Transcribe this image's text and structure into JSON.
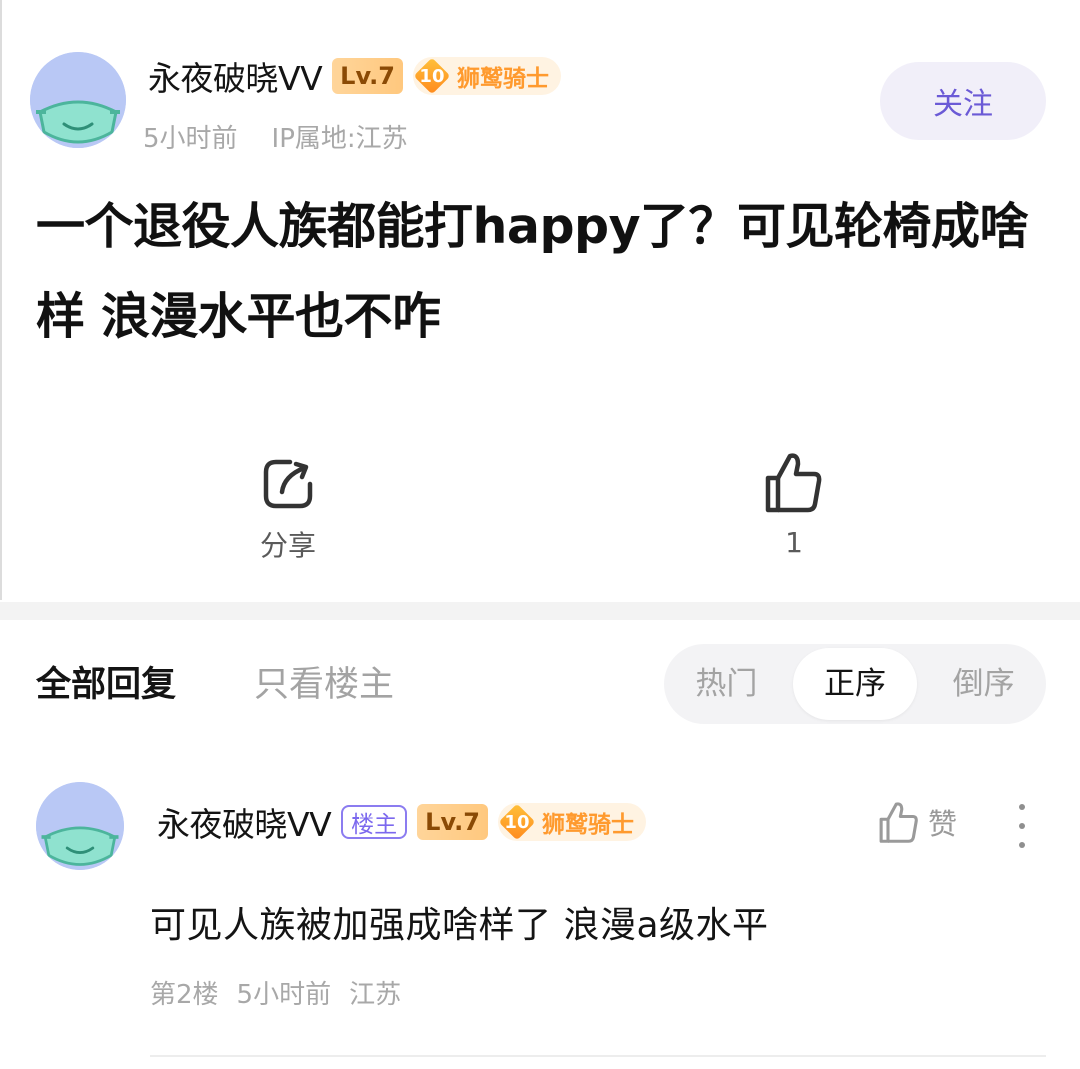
{
  "post": {
    "author": "永夜破晓VV",
    "level": "Lv.7",
    "title_badge_num": "10",
    "title_badge": "狮鹫骑士",
    "time": "5小时前",
    "ip": "IP属地:江苏",
    "follow_label": "关注",
    "title": "一个退役人族都能打happy了？可见轮椅成啥样 浪漫水平也不咋",
    "share_label": "分享",
    "like_count": "1"
  },
  "replies_header": {
    "all_label": "全部回复",
    "owner_only_label": "只看楼主",
    "sort_options": [
      "热门",
      "正序",
      "倒序"
    ],
    "active_sort": "正序"
  },
  "reply": {
    "author": "永夜破晓VV",
    "owner_badge": "楼主",
    "level": "Lv.7",
    "title_badge_num": "10",
    "title_badge": "狮鹫骑士",
    "like_label": "赞",
    "content": "可见人族被加强成啥样了 浪漫a级水平",
    "floor": "第2楼",
    "time": "5小时前",
    "location": "江苏"
  },
  "icons": {
    "avatar": "masked-face-avatar",
    "share": "share-icon",
    "like": "thumbs-up-icon",
    "more": "more-vertical-icon"
  },
  "colors": {
    "accent": "#6b5ad6",
    "level_badge": "#ffc87e",
    "title_badge": "#ff9a2e"
  }
}
